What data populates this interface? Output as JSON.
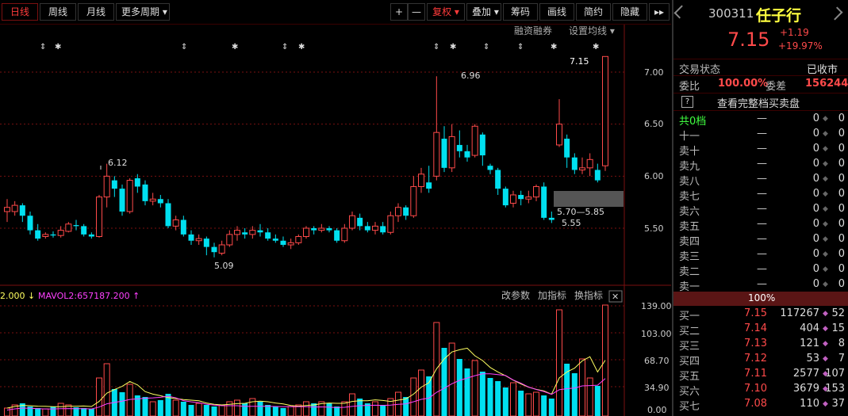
{
  "toolbar": {
    "periods": [
      "日线",
      "周线",
      "月线",
      "更多周期 ▾"
    ],
    "plus": "+",
    "minus": "—",
    "fuquan": "复权 ▾",
    "diejia": "叠加 ▾",
    "chouma": "筹码",
    "huaxian": "画线",
    "jianyue": "简约",
    "yincang": "隐藏",
    "more": "▸▸",
    "rzrq": "融资融券",
    "set_ma": "设置均线 ▾"
  },
  "chart_data": {
    "type": "candlestick",
    "y_axis_ticks": [
      "7.00",
      "6.50",
      "6.00",
      "5.50"
    ],
    "annotations": [
      "6.12",
      "6.96",
      "7.15",
      "5.70—5.85",
      "5.55",
      "5.09"
    ],
    "volume_axis_ticks": [
      "139.00",
      "103.00",
      "68.70",
      "34.90",
      "0.00"
    ],
    "candles": [
      [
        5.66,
        5.7,
        5.56,
        5.78
      ],
      [
        5.66,
        5.72,
        5.62,
        5.76
      ],
      [
        5.72,
        5.62,
        5.56,
        5.74
      ],
      [
        5.62,
        5.48,
        5.44,
        5.66
      ],
      [
        5.48,
        5.4,
        5.38,
        5.54
      ],
      [
        5.42,
        5.44,
        5.4,
        5.46
      ],
      [
        5.44,
        5.43,
        5.41,
        5.47
      ],
      [
        5.43,
        5.48,
        5.41,
        5.52
      ],
      [
        5.47,
        5.54,
        5.46,
        5.56
      ],
      [
        5.53,
        5.52,
        5.48,
        5.58
      ],
      [
        5.52,
        5.44,
        5.42,
        5.54
      ],
      [
        5.44,
        5.42,
        5.4,
        5.46
      ],
      [
        5.42,
        5.8,
        5.41,
        5.82
      ],
      [
        5.8,
        6.0,
        5.7,
        6.12
      ],
      [
        5.96,
        5.88,
        5.8,
        6.0
      ],
      [
        5.88,
        5.66,
        5.62,
        5.92
      ],
      [
        5.66,
        5.96,
        5.64,
        5.98
      ],
      [
        5.98,
        5.9,
        5.84,
        6.02
      ],
      [
        5.92,
        5.76,
        5.72,
        5.96
      ],
      [
        5.76,
        5.78,
        5.72,
        5.84
      ],
      [
        5.78,
        5.74,
        5.7,
        5.82
      ],
      [
        5.74,
        5.52,
        5.5,
        5.78
      ],
      [
        5.52,
        5.58,
        5.48,
        5.62
      ],
      [
        5.58,
        5.44,
        5.42,
        5.62
      ],
      [
        5.44,
        5.38,
        5.34,
        5.48
      ],
      [
        5.38,
        5.4,
        5.34,
        5.44
      ],
      [
        5.4,
        5.32,
        5.24,
        5.42
      ],
      [
        5.32,
        5.27,
        5.22,
        5.36
      ],
      [
        5.26,
        5.34,
        5.24,
        5.38
      ],
      [
        5.34,
        5.44,
        5.32,
        5.48
      ],
      [
        5.44,
        5.48,
        5.38,
        5.52
      ],
      [
        5.46,
        5.44,
        5.4,
        5.5
      ],
      [
        5.44,
        5.48,
        5.4,
        5.52
      ],
      [
        5.48,
        5.46,
        5.42,
        5.54
      ],
      [
        5.46,
        5.4,
        5.38,
        5.5
      ],
      [
        5.4,
        5.38,
        5.36,
        5.44
      ],
      [
        5.38,
        5.34,
        5.32,
        5.42
      ],
      [
        5.34,
        5.36,
        5.3,
        5.4
      ],
      [
        5.36,
        5.42,
        5.34,
        5.44
      ],
      [
        5.42,
        5.5,
        5.4,
        5.52
      ],
      [
        5.5,
        5.48,
        5.44,
        5.52
      ],
      [
        5.48,
        5.5,
        5.46,
        5.54
      ],
      [
        5.5,
        5.48,
        5.46,
        5.52
      ],
      [
        5.48,
        5.38,
        5.36,
        5.5
      ],
      [
        5.38,
        5.5,
        5.36,
        5.54
      ],
      [
        5.5,
        5.62,
        5.48,
        5.66
      ],
      [
        5.6,
        5.52,
        5.48,
        5.64
      ],
      [
        5.52,
        5.48,
        5.46,
        5.56
      ],
      [
        5.48,
        5.52,
        5.44,
        5.56
      ],
      [
        5.52,
        5.46,
        5.44,
        5.56
      ],
      [
        5.46,
        5.62,
        5.44,
        5.66
      ],
      [
        5.62,
        5.7,
        5.56,
        5.74
      ],
      [
        5.7,
        5.62,
        5.58,
        5.72
      ],
      [
        5.62,
        5.9,
        5.6,
        6.0
      ],
      [
        5.9,
        6.02,
        5.84,
        6.08
      ],
      [
        5.94,
        5.88,
        5.84,
        6.1
      ],
      [
        6.0,
        6.42,
        5.96,
        6.96
      ],
      [
        6.36,
        6.08,
        6.04,
        6.48
      ],
      [
        6.08,
        6.38,
        6.04,
        6.5
      ],
      [
        6.3,
        6.24,
        6.18,
        6.44
      ],
      [
        6.24,
        6.18,
        6.14,
        6.3
      ],
      [
        6.2,
        6.48,
        6.18,
        6.5
      ],
      [
        6.4,
        6.2,
        6.1,
        6.42
      ],
      [
        6.1,
        6.06,
        6.02,
        6.12
      ],
      [
        6.06,
        5.88,
        5.82,
        6.08
      ],
      [
        5.88,
        5.72,
        5.7,
        5.9
      ],
      [
        5.74,
        5.82,
        5.7,
        5.86
      ],
      [
        5.82,
        5.78,
        5.72,
        5.86
      ],
      [
        5.78,
        5.8,
        5.74,
        5.86
      ],
      [
        5.8,
        5.9,
        5.76,
        5.92
      ],
      [
        5.9,
        5.6,
        5.58,
        5.94
      ],
      [
        5.6,
        5.58,
        5.55,
        5.66
      ],
      [
        6.3,
        6.5,
        6.28,
        6.74
      ],
      [
        6.36,
        6.18,
        6.08,
        6.4
      ],
      [
        6.18,
        6.06,
        6.02,
        6.22
      ],
      [
        6.06,
        6.08,
        6.02,
        6.18
      ],
      [
        6.08,
        6.16,
        6.0,
        6.22
      ],
      [
        6.06,
        5.96,
        5.94,
        6.12
      ],
      [
        6.1,
        7.15,
        6.05,
        7.15
      ]
    ],
    "ma_lines": [
      "yellow",
      "magenta"
    ],
    "volumes": [
      10,
      14,
      16,
      12,
      10,
      9,
      12,
      16,
      14,
      11,
      10,
      9,
      48,
      66,
      34,
      30,
      40,
      26,
      24,
      18,
      20,
      28,
      20,
      18,
      14,
      16,
      14,
      12,
      14,
      18,
      20,
      16,
      22,
      18,
      14,
      12,
      10,
      12,
      14,
      18,
      16,
      18,
      16,
      12,
      18,
      28,
      22,
      16,
      18,
      14,
      22,
      30,
      24,
      48,
      58,
      50,
      118,
      86,
      92,
      72,
      60,
      70,
      56,
      48,
      44,
      36,
      42,
      32,
      28,
      30,
      26,
      22,
      134,
      66,
      54,
      72,
      48,
      38,
      140
    ],
    "vol_colors": [
      "u",
      "d"
    ]
  },
  "ma_legend": {
    "vol": "2.000 ↓",
    "vol_ma2": "MAVOL2:657187.200 ↑"
  },
  "vol_tools": {
    "params": "改参数",
    "add": "加指标",
    "swap": "换指标",
    "close": "✕"
  },
  "stock": {
    "code": "300311",
    "name": "任子行",
    "price": "7.15",
    "change": "+1.19",
    "pct": "+19.97%"
  },
  "status": {
    "label": "交易状态",
    "value": "已收市"
  },
  "weibi": {
    "label": "委比",
    "value": "100.00%",
    "label2": "委差",
    "value2": "156244"
  },
  "full_book": {
    "icon": "?",
    "label": "查看完整档买卖盘"
  },
  "ask_total": {
    "name": "共0档",
    "price": "—",
    "vol": "0",
    "cnt": "0"
  },
  "asks": [
    {
      "name": "十一",
      "price": "—",
      "vol": "0",
      "cnt": "0"
    },
    {
      "name": "卖十",
      "price": "—",
      "vol": "0",
      "cnt": "0"
    },
    {
      "name": "卖九",
      "price": "—",
      "vol": "0",
      "cnt": "0"
    },
    {
      "name": "卖八",
      "price": "—",
      "vol": "0",
      "cnt": "0"
    },
    {
      "name": "卖七",
      "price": "—",
      "vol": "0",
      "cnt": "0"
    },
    {
      "name": "卖六",
      "price": "—",
      "vol": "0",
      "cnt": "0"
    },
    {
      "name": "卖五",
      "price": "—",
      "vol": "0",
      "cnt": "0"
    },
    {
      "name": "卖四",
      "price": "—",
      "vol": "0",
      "cnt": "0"
    },
    {
      "name": "卖三",
      "price": "—",
      "vol": "0",
      "cnt": "0"
    },
    {
      "name": "卖二",
      "price": "—",
      "vol": "0",
      "cnt": "0"
    },
    {
      "name": "卖一",
      "price": "—",
      "vol": "0",
      "cnt": "0"
    }
  ],
  "ratio_bar": "100%",
  "bids": [
    {
      "name": "买一",
      "price": "7.15",
      "vol": "117267",
      "cnt": "52"
    },
    {
      "name": "买二",
      "price": "7.14",
      "vol": "404",
      "cnt": "15"
    },
    {
      "name": "买三",
      "price": "7.13",
      "vol": "121",
      "cnt": "8"
    },
    {
      "name": "买四",
      "price": "7.12",
      "vol": "53",
      "cnt": "7"
    },
    {
      "name": "买五",
      "price": "7.11",
      "vol": "2577",
      "cnt": "107"
    },
    {
      "name": "买六",
      "price": "7.10",
      "vol": "3679",
      "cnt": "153"
    },
    {
      "name": "买七",
      "price": "7.08",
      "vol": "110",
      "cnt": "37"
    }
  ],
  "colors": {
    "up": "#ff4a4a",
    "down": "#00e0f0",
    "grid": "#7a1010",
    "ma5": "#ffff60",
    "ma10": "#ff40ff"
  }
}
